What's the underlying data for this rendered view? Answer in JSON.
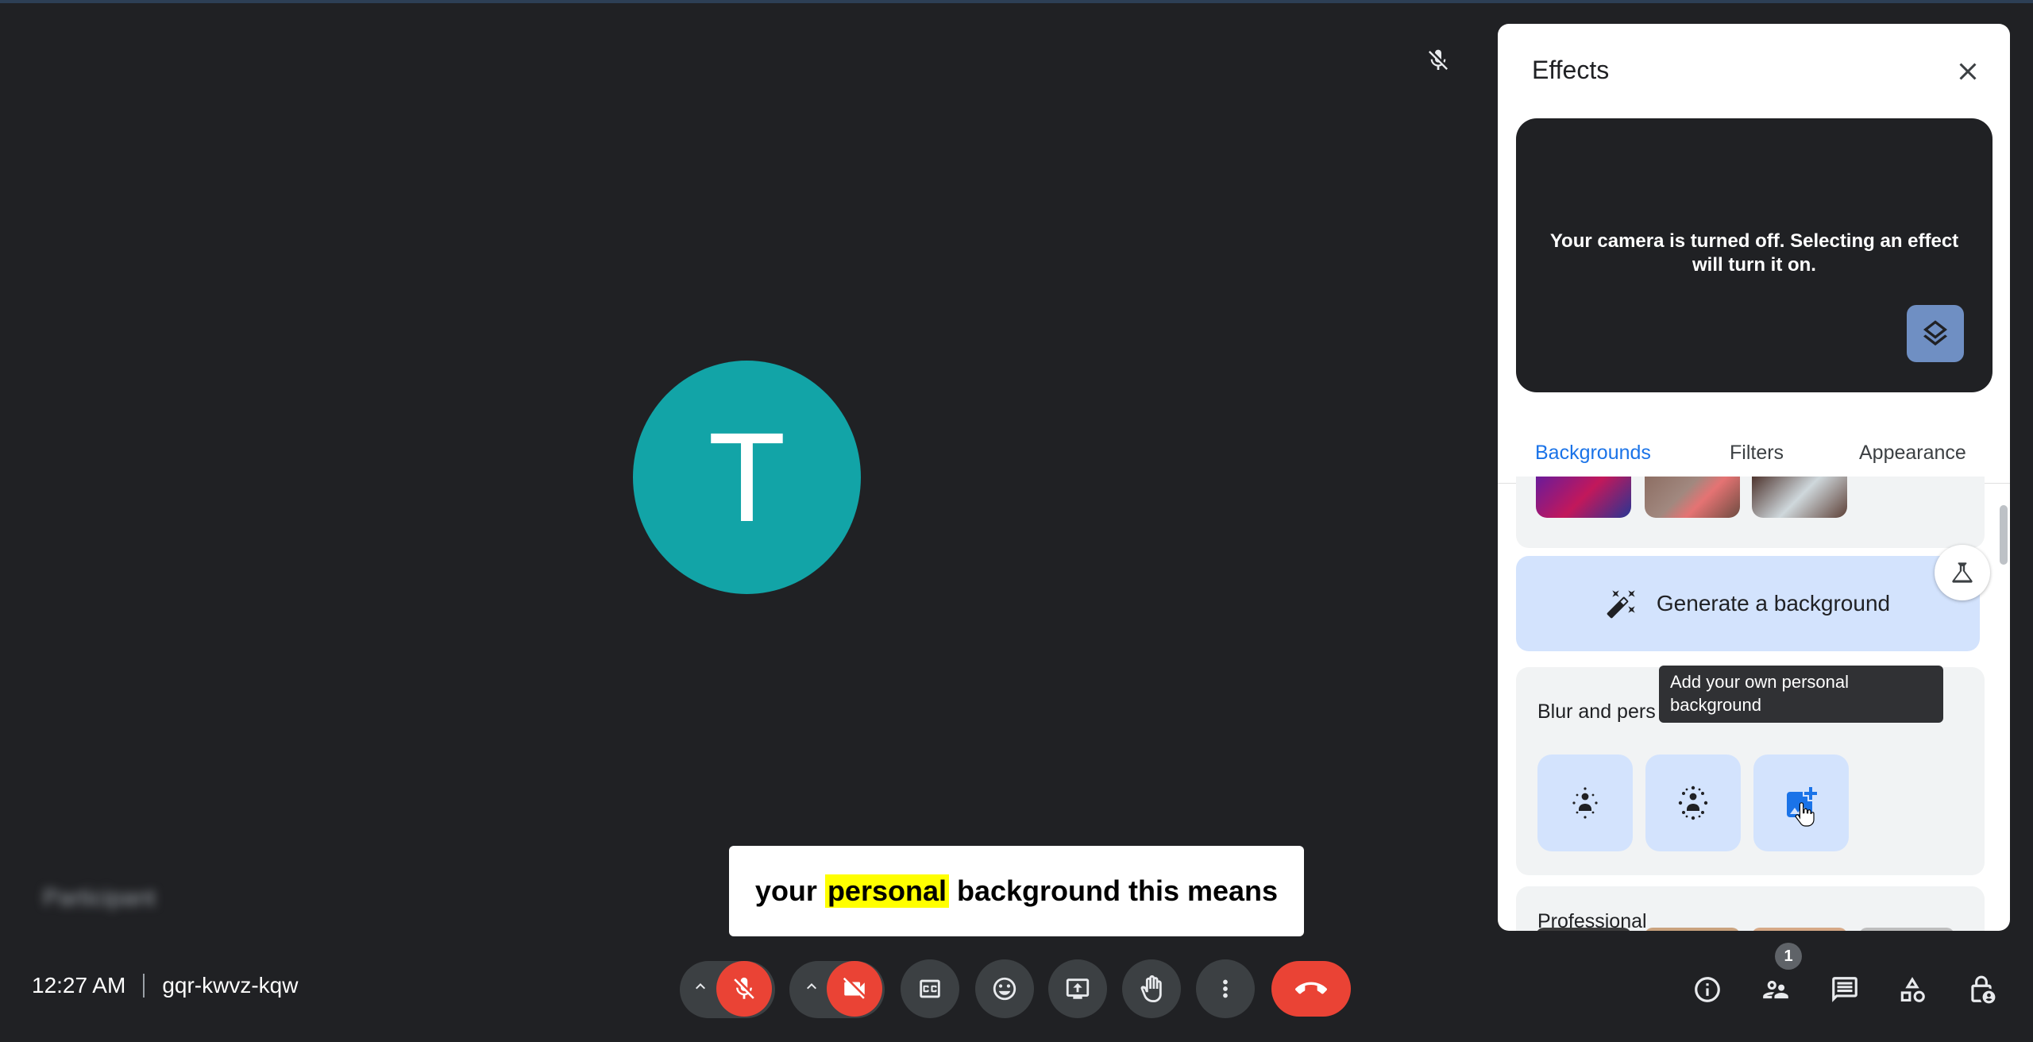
{
  "stage": {
    "avatar_letter": "T",
    "participant_name": "Participant",
    "caption": {
      "before": "your",
      "highlight": "personal",
      "after": "background this means"
    }
  },
  "meeting": {
    "time": "12:27 AM",
    "code": "gqr-kwvz-kqw"
  },
  "controls": {
    "mic_icon": "mic-off-icon",
    "camera_icon": "videocam-off-icon",
    "captions_icon": "closed-caption-icon",
    "emoji_icon": "emoji-icon",
    "present_icon": "present-screen-icon",
    "raise_hand_icon": "raise-hand-icon",
    "more_icon": "more-vert-icon",
    "hangup_icon": "call-end-icon",
    "people_count": "1"
  },
  "panel": {
    "title": "Effects",
    "preview_message": "Your camera is turned off. Selecting an effect will turn it on.",
    "tabs": [
      "Backgrounds",
      "Filters",
      "Appearance"
    ],
    "active_tab": "Backgrounds",
    "generate_label": "Generate a background",
    "blur_section_label": "Blur and pers",
    "tooltip": "Add your own personal background",
    "professional_label": "Professional"
  },
  "colors": {
    "accent": "#1a73e8",
    "danger": "#ea4335",
    "avatar": "#12a4a7",
    "caption_highlight": "#ffff00"
  }
}
